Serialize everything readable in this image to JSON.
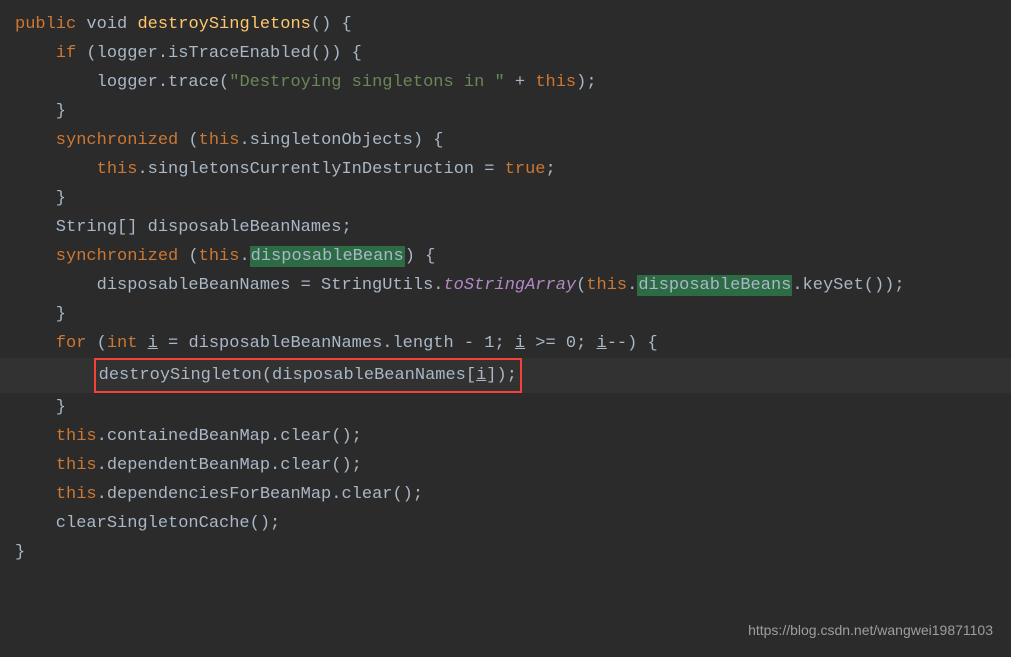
{
  "code": {
    "line1_public": "public",
    "line1_void": " void ",
    "line1_method": "destroySingletons",
    "line1_end": "() {",
    "line2_if": "    if",
    "line2_rest": " (logger.isTraceEnabled()) {",
    "line3_pre": "        logger.trace(",
    "line3_string": "\"Destroying singletons in \"",
    "line3_plus": " + ",
    "line3_this": "this",
    "line3_end": ");",
    "line4": "    }",
    "line5_sync": "    synchronized ",
    "line5_lparen": "(",
    "line5_this": "this",
    "line5_rest": ".singletonObjects) {",
    "line6_pre": "        ",
    "line6_this": "this",
    "line6_mid": ".singletonsCurrentlyInDestruction = ",
    "line6_true": "true",
    "line6_end": ";",
    "line7": "    }",
    "line8": "",
    "line9": "    String[] disposableBeanNames;",
    "line10_sync": "    synchronized ",
    "line10_lparen": "(",
    "line10_this": "this",
    "line10_dot": ".",
    "line10_hl": "disposableBeans",
    "line10_end": ") {",
    "line11_pre": "        disposableBeanNames = StringUtils.",
    "line11_static": "toStringArray",
    "line11_lparen": "(",
    "line11_this": "this",
    "line11_dot": ".",
    "line11_hl": "disposableBeans",
    "line11_end": ".keySet());",
    "line12": "    }",
    "line13_for": "    for ",
    "line13_lparen": "(",
    "line13_int": "int ",
    "line13_i1": "i",
    "line13_mid1": " = disposableBeanNames.length - ",
    "line13_one": "1",
    "line13_semi": "; ",
    "line13_i2": "i",
    "line13_mid2": " >= ",
    "line13_zero": "0",
    "line13_semi2": "; ",
    "line13_i3": "i",
    "line13_end": "--) {",
    "line14_pre": "        ",
    "line14_call": "destroySingleton(disposableBeanNames[",
    "line14_i": "i",
    "line14_end": "]);",
    "line15": "    }",
    "line16": "",
    "line17_pre": "    ",
    "line17_this": "this",
    "line17_rest": ".containedBeanMap.clear();",
    "line18_pre": "    ",
    "line18_this": "this",
    "line18_rest": ".dependentBeanMap.clear();",
    "line19_pre": "    ",
    "line19_this": "this",
    "line19_rest": ".dependenciesForBeanMap.clear();",
    "line20": "",
    "line21": "    clearSingletonCache();",
    "line22": "}"
  },
  "watermark": "https://blog.csdn.net/wangwei19871103",
  "highlights": {
    "red_box_content": "destroySingleton(disposableBeanNames[i]);",
    "green_highlights": [
      "disposableBeans",
      "disposableBeans"
    ]
  }
}
